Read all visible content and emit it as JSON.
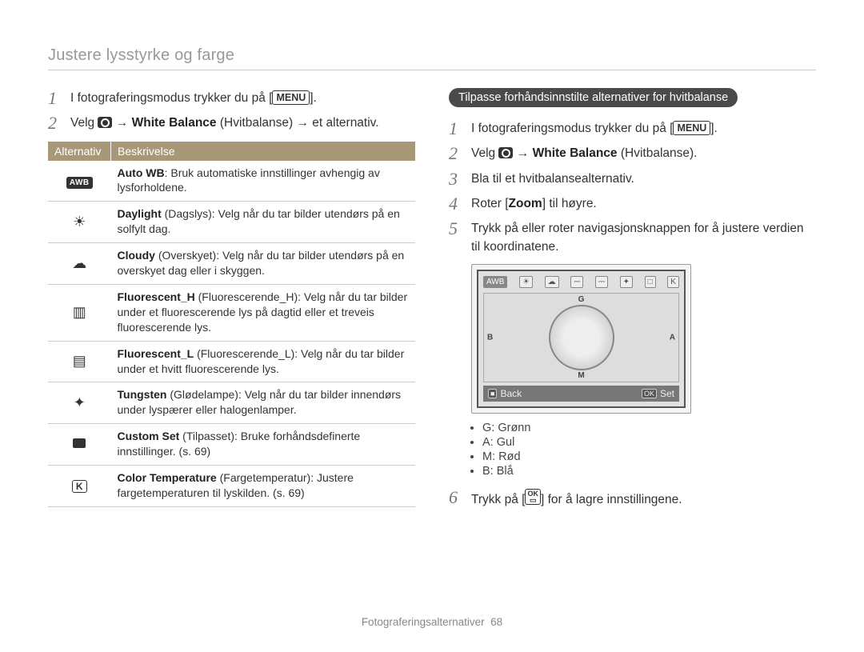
{
  "header": {
    "title": "Justere lysstyrke og farge"
  },
  "left": {
    "steps": [
      {
        "num": "1",
        "text_before": "I fotograferingsmodus trykker du på [",
        "btn": "MENU",
        "text_after": "]."
      },
      {
        "num": "2",
        "text_before": "Velg ",
        "icon": "camera",
        "arrow1": " → ",
        "bold1": "White Balance",
        "paren": " (Hvitbalanse) ",
        "arrow2": "→ et alternativ."
      }
    ],
    "table": {
      "headers": {
        "opt": "Alternativ",
        "desc": "Beskrivelse"
      },
      "rows": [
        {
          "icon": "awb",
          "bold": "Auto WB",
          "rest": ": Bruk automatiske innstillinger avhengig av lysforholdene."
        },
        {
          "icon": "sun",
          "bold": "Daylight",
          "paren": " (Dagslys)",
          "rest": ": Velg når du tar bilder utendørs på en solfylt dag."
        },
        {
          "icon": "cloud",
          "bold": "Cloudy",
          "paren": " (Overskyet)",
          "rest": ": Velg når du tar bilder utendørs på en overskyet dag eller i skyggen."
        },
        {
          "icon": "fluoH",
          "bold": "Fluorescent_H",
          "paren": " (Fluorescerende_H)",
          "rest": ": Velg når du tar bilder under et fluorescerende lys på dagtid eller et treveis fluorescerende lys."
        },
        {
          "icon": "fluoL",
          "bold": "Fluorescent_L",
          "paren": " (Fluorescerende_L)",
          "rest": ": Velg når du tar bilder under et hvitt fluorescerende lys."
        },
        {
          "icon": "tungsten",
          "bold": "Tungsten",
          "paren": " (Glødelampe)",
          "rest": ": Velg når du tar bilder innendørs under lyspærer eller halogenlamper."
        },
        {
          "icon": "custom",
          "bold": "Custom Set",
          "paren": " (Tilpasset)",
          "rest": ": Bruke forhåndsdefinerte innstillinger. (s. 69)"
        },
        {
          "icon": "K",
          "bold": "Color Temperature",
          "paren": " (Fargetemperatur)",
          "rest": ": Justere fargetemperaturen til lyskilden. (s. 69)"
        }
      ]
    }
  },
  "right": {
    "badge": "Tilpasse forhåndsinnstilte alternativer for hvitbalanse",
    "steps": [
      {
        "num": "1",
        "text_before": "I fotograferingsmodus trykker du på [",
        "btn": "MENU",
        "text_after": "]."
      },
      {
        "num": "2",
        "text_before": "Velg ",
        "icon": "camera",
        "arrow": " → ",
        "bold": "White Balance",
        "paren": " (Hvitbalanse)."
      },
      {
        "num": "3",
        "text": "Bla til et hvitbalansealternativ."
      },
      {
        "num": "4",
        "text_before": "Roter [",
        "bold": "Zoom",
        "text_after": "] til høyre."
      },
      {
        "num": "5",
        "text": "Trykk på eller roter navigasjonsknappen for å justere verdien til koordinatene."
      }
    ],
    "device": {
      "wb_icons": [
        "AWB",
        "☀",
        "☁",
        "⎓",
        "⎓",
        "✦",
        "□",
        "K"
      ],
      "axis": {
        "top": "G",
        "right": "A",
        "bottom": "M",
        "left": "B"
      },
      "back_btn": "■",
      "back_label": "Back",
      "set_btn": "OK",
      "set_label": "Set"
    },
    "legend": [
      "G: Grønn",
      "A: Gul",
      "M: Rød",
      "B: Blå"
    ],
    "step6": {
      "num": "6",
      "text_before": "Trykk på [",
      "ok": "OK",
      "text_after": "] for å lagre innstillingene."
    }
  },
  "footer": {
    "section": "Fotograferingsalternativer",
    "page": "68"
  }
}
